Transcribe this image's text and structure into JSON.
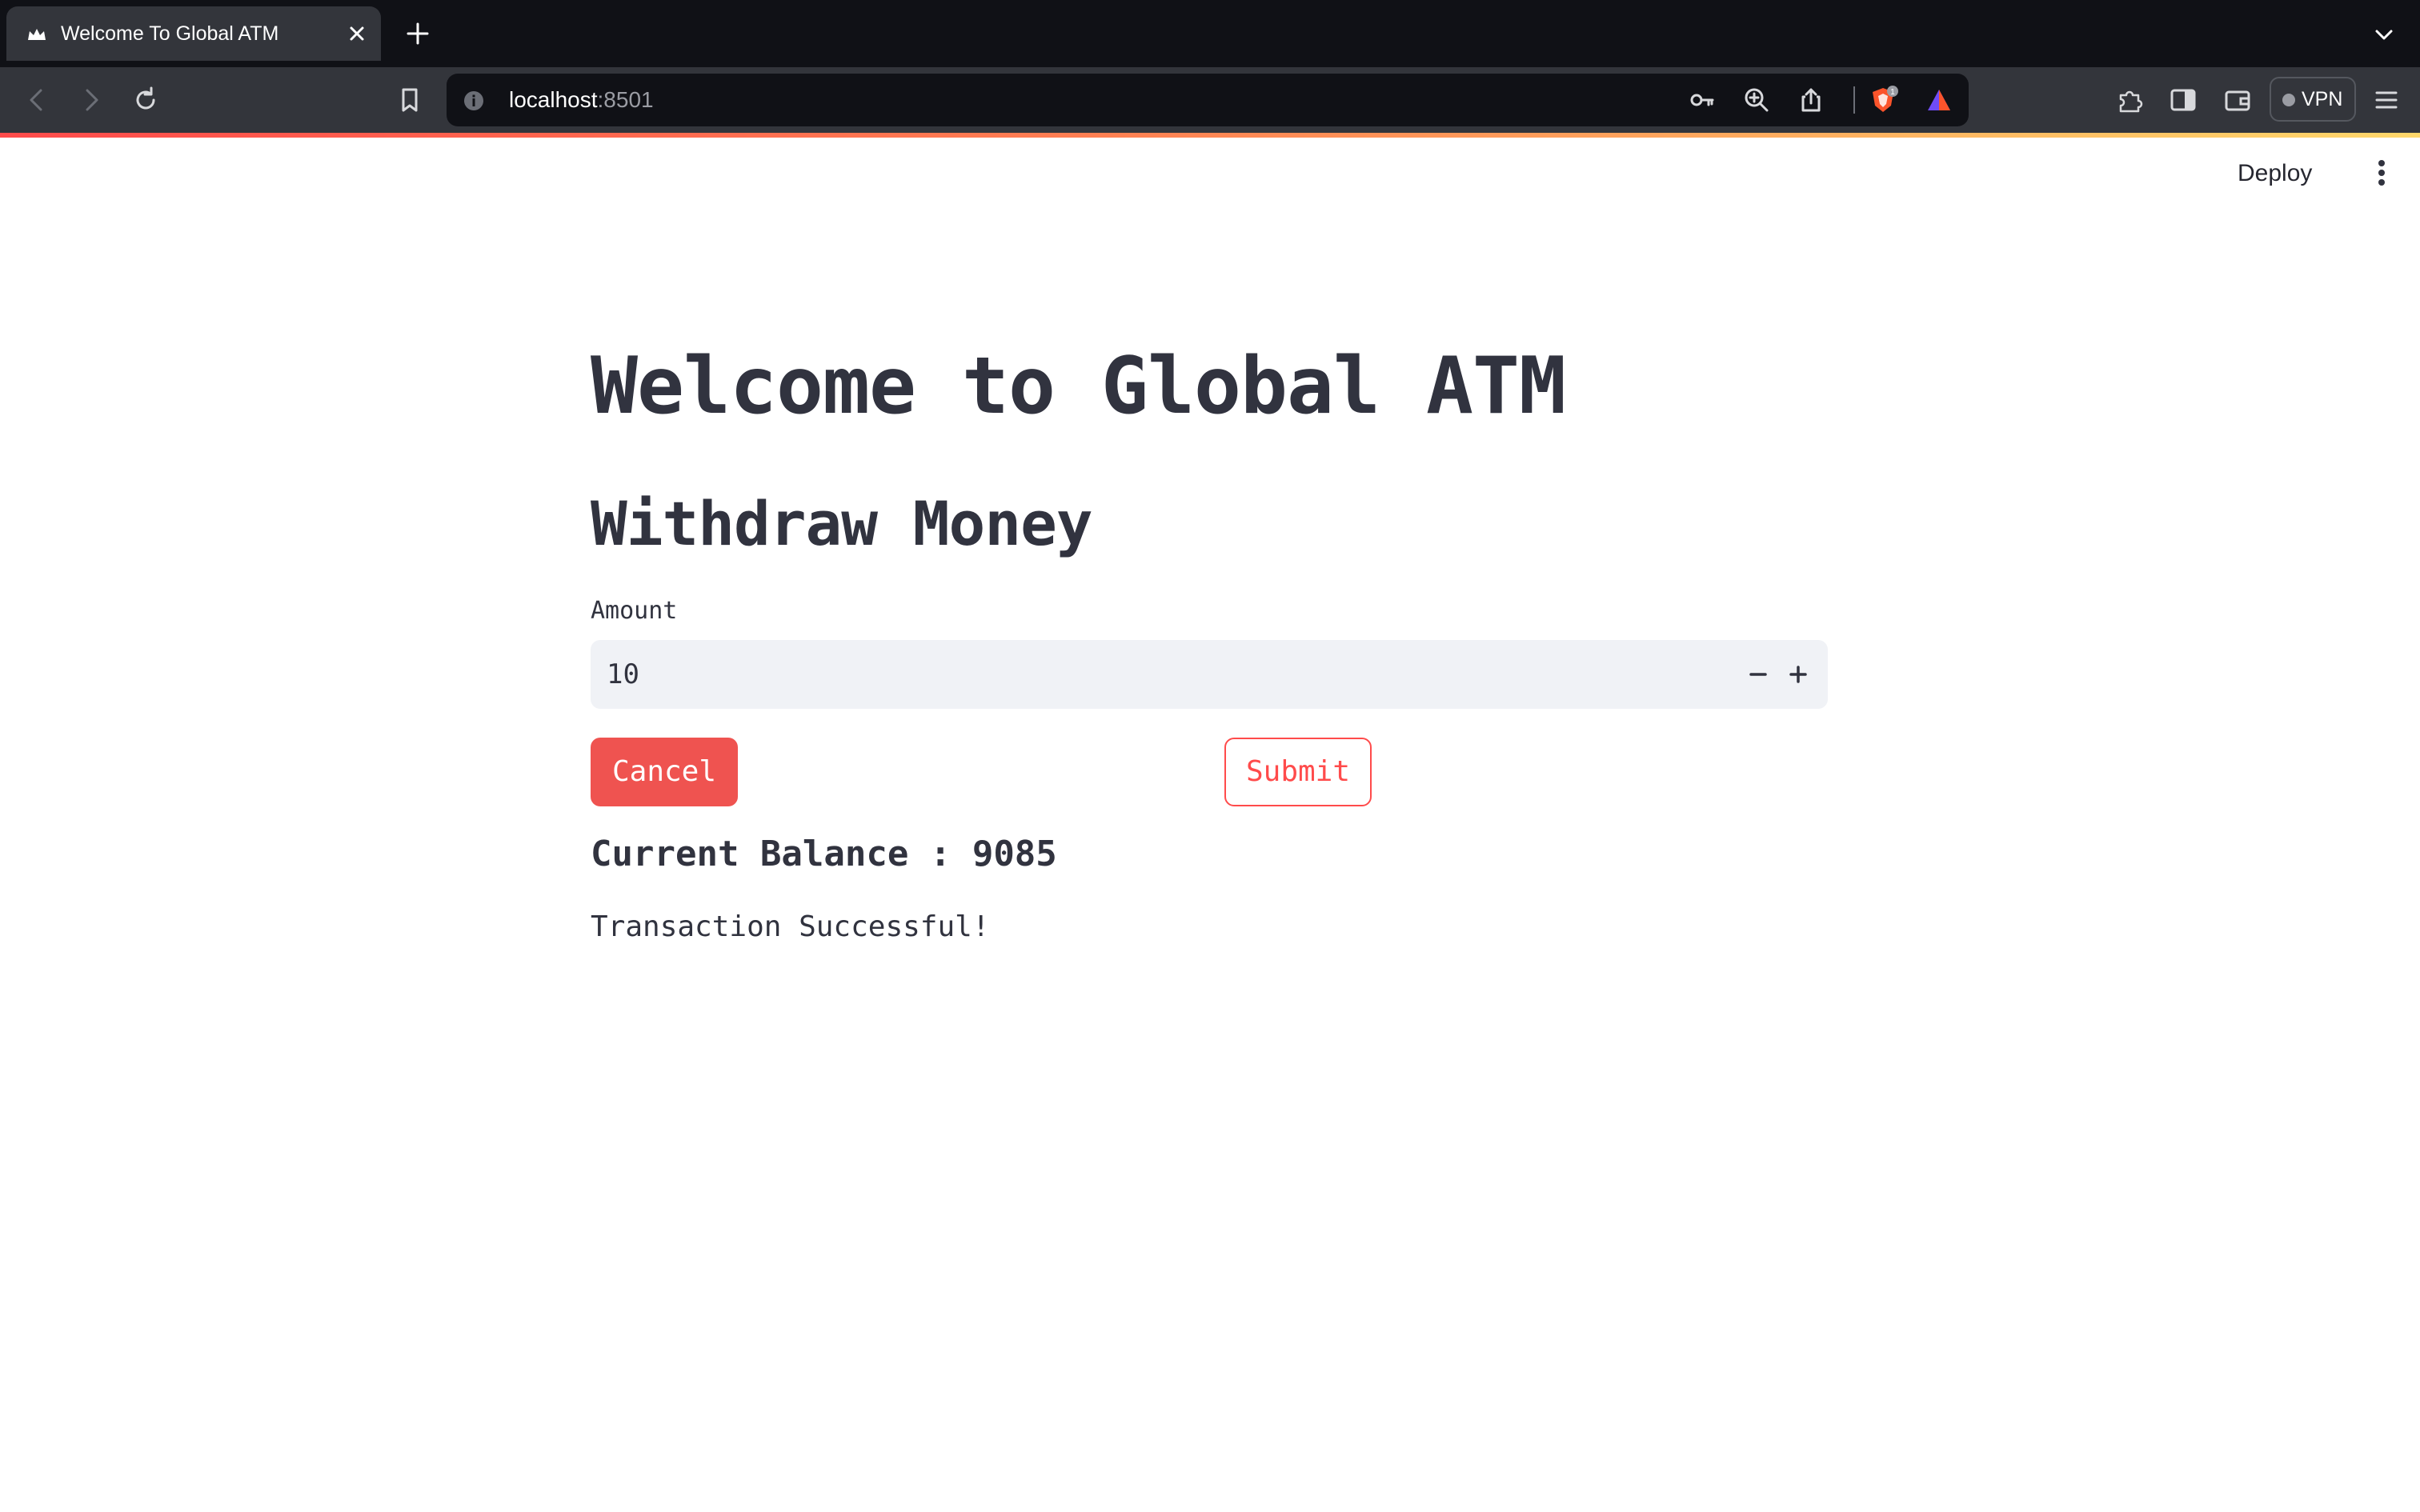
{
  "browser": {
    "tab_title": "Welcome To Global ATM",
    "url_host": "localhost",
    "url_port": ":8501",
    "vpn_label": "VPN",
    "shields_badge": "1"
  },
  "app": {
    "deploy_label": "Deploy",
    "title": "Welcome to Global ATM",
    "subheader": "Withdraw Money",
    "amount_label": "Amount",
    "amount_value": "10",
    "cancel_label": "Cancel",
    "submit_label": "Submit",
    "balance_text": "Current Balance : 9085",
    "status_message": "Transaction Successful!"
  },
  "icons": {
    "favicon": "streamlit-crown-icon",
    "tab_close": "close-icon",
    "new_tab": "plus-icon",
    "tab_menu": "chevron-down-icon",
    "back": "arrow-left-icon",
    "forward": "arrow-right-icon",
    "reload": "reload-icon",
    "bookmark": "bookmark-icon",
    "site_info": "info-icon",
    "password": "key-icon",
    "zoom": "zoom-in-icon",
    "share": "share-icon",
    "shields": "brave-shields-icon",
    "rewards": "brave-rewards-icon",
    "extensions": "puzzle-icon",
    "sidebar": "sidebar-icon",
    "wallet": "wallet-icon",
    "menu": "hamburger-icon",
    "app_menu": "kebab-menu-icon",
    "decrement": "minus-icon",
    "increment": "plus-icon"
  },
  "colors": {
    "primary": "#ff4b4b",
    "cancel_bg": "#ef5350",
    "text": "#31333f",
    "input_bg": "#f0f2f6"
  }
}
